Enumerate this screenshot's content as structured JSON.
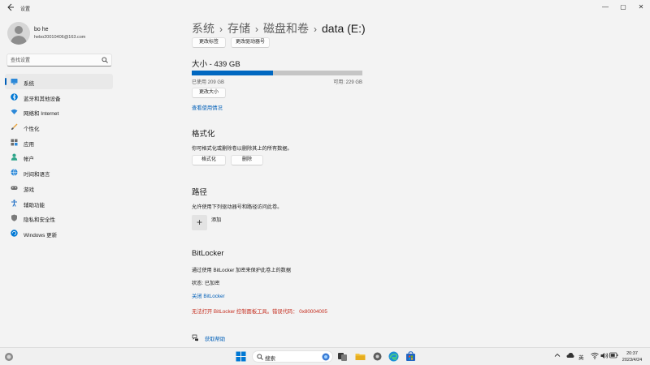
{
  "window": {
    "title": "设置",
    "controls": {
      "minimize": "—",
      "maximize": "▢",
      "close": "✕"
    }
  },
  "profile": {
    "name": "bo he",
    "email": "hebo20010406@163.com"
  },
  "search": {
    "placeholder": "查找设置"
  },
  "nav": [
    {
      "label": "系统",
      "icon": "system-icon",
      "active": true
    },
    {
      "label": "蓝牙和其他设备",
      "icon": "bluetooth-icon"
    },
    {
      "label": "网络和 Internet",
      "icon": "wifi-icon"
    },
    {
      "label": "个性化",
      "icon": "brush-icon"
    },
    {
      "label": "应用",
      "icon": "apps-icon"
    },
    {
      "label": "帐户",
      "icon": "account-icon"
    },
    {
      "label": "时间和语言",
      "icon": "globe-clock-icon"
    },
    {
      "label": "游戏",
      "icon": "gamepad-icon"
    },
    {
      "label": "辅助功能",
      "icon": "accessibility-icon"
    },
    {
      "label": "隐私和安全性",
      "icon": "shield-icon"
    },
    {
      "label": "Windows 更新",
      "icon": "update-icon"
    }
  ],
  "breadcrumb": {
    "items": [
      "系统",
      "存储",
      "磁盘和卷"
    ],
    "separator": "›",
    "current": "data (E:)"
  },
  "top_buttons": {
    "change_label": "更改标签",
    "change_drive_letter": "更改驱动器号"
  },
  "size": {
    "title": "大小 - 439 GB",
    "used": "已使用 209 GB",
    "available": "可用: 229 GB",
    "used_fraction": 0.476,
    "resize_button": "更改大小",
    "view_usage_link": "查看使用情况"
  },
  "format": {
    "title": "格式化",
    "description": "你可格式化或删除卷以删除其上的所有数据。",
    "format_button": "格式化",
    "delete_button": "删除"
  },
  "path": {
    "title": "路径",
    "description": "允许使用下列驱动器号和路径访问此卷。",
    "add_symbol": "+",
    "add_label": "添加"
  },
  "bitlocker": {
    "title": "BitLocker",
    "description": "通过使用 BitLocker 加密来保护此卷上的数据",
    "status": "状态: 已加密",
    "turn_off_link": "关闭 BitLocker",
    "error": "无法打开 BitLocker 控制面板工具。错误代码： 0x80004005"
  },
  "help": {
    "label": "获取帮助"
  },
  "taskbar": {
    "search_label": "搜索",
    "ime": "英",
    "time": "20:37",
    "date": "2023/4/24"
  },
  "colors": {
    "accent": "#0067c0",
    "link": "#005fb8",
    "error": "#c42b1c",
    "bar_track": "#c5c5c5"
  }
}
